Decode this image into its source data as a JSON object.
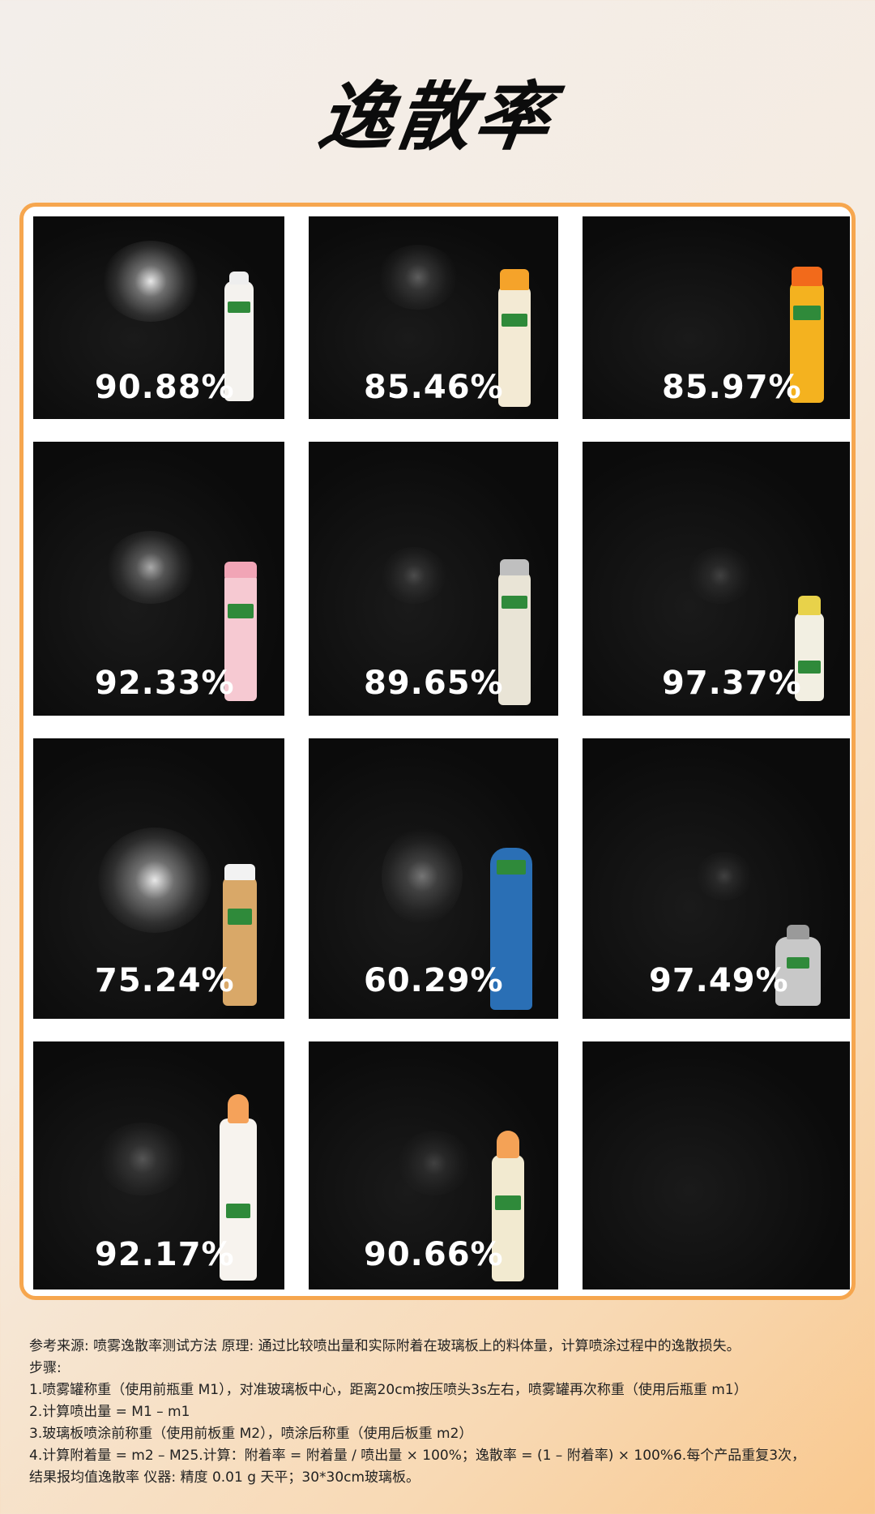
{
  "title": "逸散率",
  "results": [
    {
      "value": "90.88%",
      "product_color": "#f4f2ee"
    },
    {
      "value": "85.46%",
      "product_color": "#f3ead4"
    },
    {
      "value": "85.97%",
      "product_color": "#f4b21f"
    },
    {
      "value": "92.33%",
      "product_color": "#f6c9d2"
    },
    {
      "value": "89.65%",
      "product_color": "#e9e4d6"
    },
    {
      "value": "97.37%",
      "product_color": "#f2efe2"
    },
    {
      "value": "75.24%",
      "product_color": "#d9a868"
    },
    {
      "value": "60.29%",
      "product_color": "#2a6fb5"
    },
    {
      "value": "97.49%",
      "product_color": "#c8c8c8"
    },
    {
      "value": "92.17%",
      "product_color": "#f7f3ee"
    },
    {
      "value": "90.66%",
      "product_color": "#f2ead0"
    }
  ],
  "notes": [
    "参考来源: 喷雾逸散率测试方法 原理: 通过比较喷出量和实际附着在玻璃板上的料体量，计算喷涂过程中的逸散损失。",
    "步骤:",
    "1.喷雾罐称重（使用前瓶重 M1），对准玻璃板中心，距离20cm按压喷头3s左右，喷雾罐再次称重（使用后瓶重 m1）",
    "2.计算喷出量 = M1 – m1",
    "3.玻璃板喷涂前称重（使用前板重 M2），喷涂后称重（使用后板重 m2）",
    "4.计算附着量 = m2 – M25.计算：附着率 = 附着量 / 喷出量 × 100%；逸散率 = (1 – 附着率) × 100%6.每个产品重复3次，",
    "结果报均值逸散率 仪器: 精度 0.01 g 天平；30*30cm玻璃板。"
  ]
}
